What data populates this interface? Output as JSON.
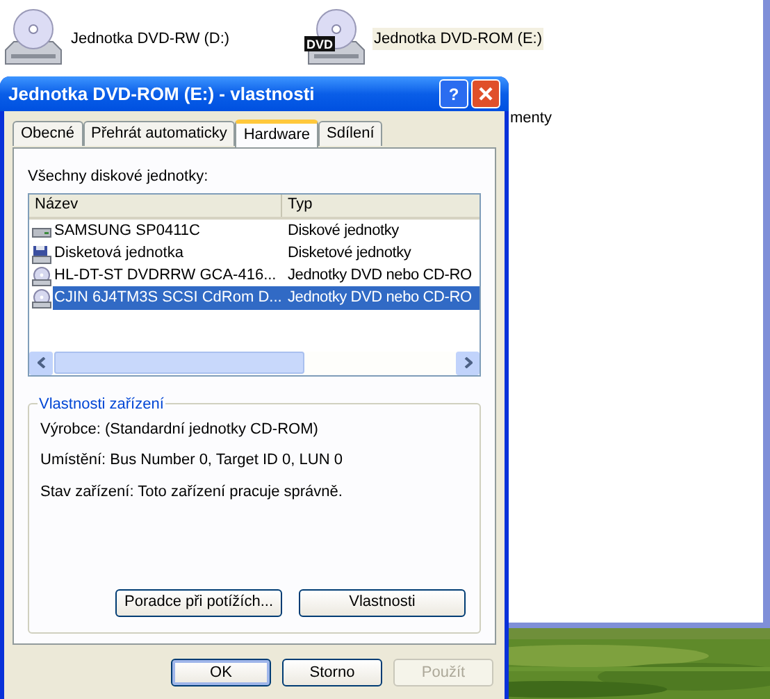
{
  "explorer": {
    "items": [
      {
        "label": "Jednotka DVD-RW (D:)",
        "kind": "cd",
        "selected": false
      },
      {
        "label": "Jednotka DVD-ROM (E:)",
        "kind": "dvd",
        "badge": "DVD",
        "selected": true
      }
    ],
    "partial_label": "menty"
  },
  "dialog": {
    "title": "Jednotka DVD-ROM (E:) - vlastnosti",
    "help": "?",
    "tabs": [
      {
        "label": "Obecné",
        "selected": false
      },
      {
        "label": "Přehrát automaticky",
        "selected": false
      },
      {
        "label": "Hardware",
        "selected": true
      },
      {
        "label": "Sdílení",
        "selected": false
      }
    ],
    "list_label": "Všechny diskové jednotky:",
    "columns": [
      "Název",
      "Typ"
    ],
    "rows": [
      {
        "name": "SAMSUNG SP0411C",
        "type": "Diskové jednotky",
        "kind": "hdd",
        "selected": false
      },
      {
        "name": "Disketová jednotka",
        "type": "Disketové jednotky",
        "kind": "floppy",
        "selected": false
      },
      {
        "name": "HL-DT-ST DVDRRW GCA-416...",
        "type": "Jednotky DVD nebo CD-RO",
        "kind": "cd",
        "selected": false
      },
      {
        "name": "CJIN 6J4TM3S SCSI CdRom D...",
        "type": "Jednotky DVD nebo CD-RO",
        "kind": "cd",
        "selected": true
      }
    ],
    "group_title": "Vlastnosti zařízení",
    "properties": [
      "Výrobce: (Standardní jednotky CD-ROM)",
      "Umístění: Bus Number 0, Target ID 0, LUN 0",
      "Stav zařízení: Toto zařízení pracuje správně."
    ],
    "group_buttons": [
      "Poradce při potížích...",
      "Vlastnosti"
    ],
    "buttons": [
      {
        "label": "OK",
        "disabled": false,
        "default": true
      },
      {
        "label": "Storno",
        "disabled": false,
        "default": false
      },
      {
        "label": "Použít",
        "disabled": true,
        "default": false
      }
    ]
  }
}
